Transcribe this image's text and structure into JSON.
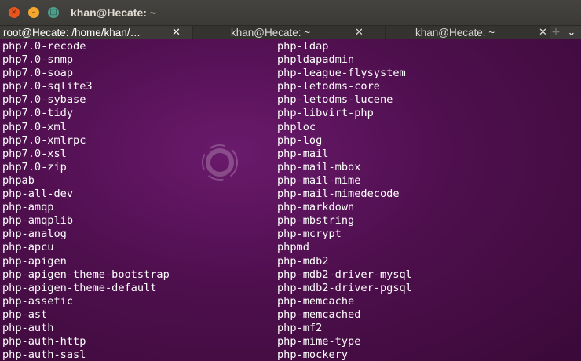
{
  "window": {
    "title": "khan@Hecate: ~",
    "buttons": {
      "close": "×",
      "minimize": "–",
      "maximize": "□"
    }
  },
  "tabs": [
    {
      "label": "root@Hecate: /home/khan/…",
      "close": "✕"
    },
    {
      "label": "khan@Hecate: ~",
      "close": "✕"
    },
    {
      "label": "khan@Hecate: ~",
      "close": "✕"
    }
  ],
  "tab_new_glyph": "+",
  "tab_menu_glyph": "⌄",
  "terminal": {
    "left_column": [
      "php7.0-recode",
      "php7.0-snmp",
      "php7.0-soap",
      "php7.0-sqlite3",
      "php7.0-sybase",
      "php7.0-tidy",
      "php7.0-xml",
      "php7.0-xmlrpc",
      "php7.0-xsl",
      "php7.0-zip",
      "phpab",
      "php-all-dev",
      "php-amqp",
      "php-amqplib",
      "php-analog",
      "php-apcu",
      "php-apigen",
      "php-apigen-theme-bootstrap",
      "php-apigen-theme-default",
      "php-assetic",
      "php-ast",
      "php-auth",
      "php-auth-http",
      "php-auth-sasl"
    ],
    "right_column": [
      "php-ldap",
      "phpldapadmin",
      "php-league-flysystem",
      "php-letodms-core",
      "php-letodms-lucene",
      "php-libvirt-php",
      "phploc",
      "php-log",
      "php-mail",
      "php-mail-mbox",
      "php-mail-mime",
      "php-mail-mimedecode",
      "php-markdown",
      "php-mbstring",
      "php-mcrypt",
      "phpmd",
      "php-mdb2",
      "php-mdb2-driver-mysql",
      "php-mdb2-driver-pgsql",
      "php-memcache",
      "php-memcached",
      "php-mf2",
      "php-mime-type",
      "php-mockery"
    ]
  },
  "colors": {
    "terminal_background": "#4f0f4e",
    "terminal_text": "#ffffff",
    "titlebar": "#3c3b37",
    "close_button": "#e9541f",
    "minimize_button": "#f4a72d",
    "maximize_button": "#4d9e8d"
  }
}
